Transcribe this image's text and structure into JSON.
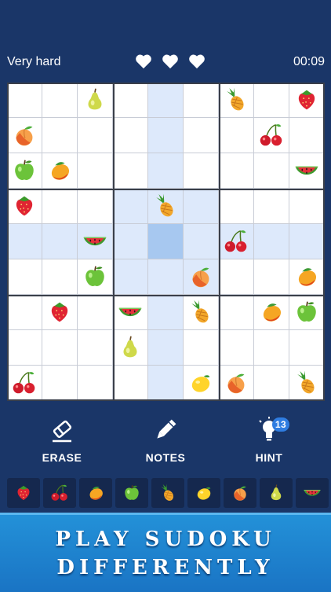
{
  "header": {
    "difficulty": "Very hard",
    "lives": 3,
    "timer": "00:09"
  },
  "fruits": {
    "strawberry": "strawberry-icon",
    "cherry": "cherry-icon",
    "mango": "mango-icon",
    "apple": "green-apple-icon",
    "pineapple": "pineapple-icon",
    "lemon": "lemon-icon",
    "peach": "peach-icon",
    "pear": "pear-icon",
    "watermelon": "watermelon-icon"
  },
  "board": [
    [
      "",
      "",
      "pear",
      "",
      "",
      "",
      "pineapple",
      "",
      "strawberry"
    ],
    [
      "peach",
      "",
      "",
      "",
      "",
      "",
      "",
      "cherry",
      ""
    ],
    [
      "apple",
      "mango",
      "",
      "",
      "",
      "",
      "",
      "",
      "watermelon"
    ],
    [
      "strawberry",
      "",
      "",
      "",
      "pineapple",
      "",
      "",
      "",
      ""
    ],
    [
      "",
      "",
      "watermelon",
      "",
      "",
      "",
      "cherry",
      "",
      ""
    ],
    [
      "",
      "",
      "apple",
      "",
      "",
      "peach",
      "",
      "",
      "mango"
    ],
    [
      "",
      "strawberry",
      "",
      "watermelon",
      "",
      "pineapple",
      "",
      "mango",
      "apple"
    ],
    [
      "",
      "",
      "",
      "pear",
      "",
      "",
      "",
      "",
      ""
    ],
    [
      "cherry",
      "",
      "",
      "",
      "",
      "lemon",
      "peach",
      "",
      "pineapple"
    ]
  ],
  "selected": {
    "row": 4,
    "col": 4
  },
  "tools": {
    "erase": "ERASE",
    "notes": "NOTES",
    "hint": "HINT",
    "hint_count": "13"
  },
  "palette": [
    "strawberry",
    "cherry",
    "mango",
    "apple",
    "pineapple",
    "lemon",
    "peach",
    "pear",
    "watermelon"
  ],
  "banner": {
    "line1": "PLAY SUDOKU",
    "line2": "DIFFERENTLY"
  }
}
